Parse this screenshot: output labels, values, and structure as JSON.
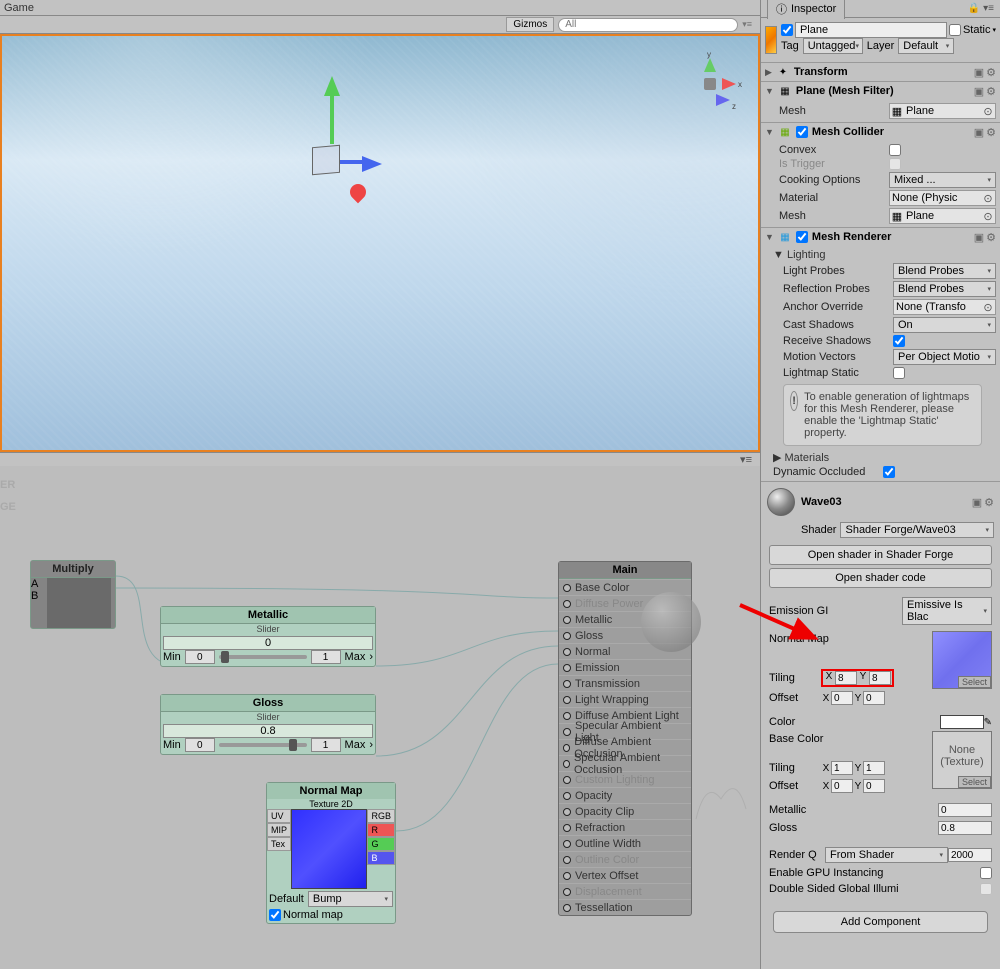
{
  "game": {
    "title": "Game",
    "gizmos": "Gizmos",
    "search_ph": "All"
  },
  "watermark1": "ER",
  "watermark2": "GE",
  "nodes": {
    "multiply": {
      "title": "Multiply"
    },
    "metallic": {
      "title": "Metallic",
      "sub": "Slider",
      "val": "0",
      "min": "Min",
      "minv": "0",
      "max": "Max",
      "maxv": "1"
    },
    "gloss": {
      "title": "Gloss",
      "sub": "Slider",
      "val": "0.8",
      "min": "Min",
      "minv": "0",
      "max": "Max",
      "maxv": "1"
    },
    "normalmap": {
      "title": "Normal Map",
      "sub": "Texture 2D",
      "uv": "UV",
      "mip": "MIP",
      "tex": "Tex",
      "rgb": "RGB",
      "r": "R",
      "g": "G",
      "b": "B",
      "def": "Default",
      "bump": "Bump",
      "nm": "Normal map"
    },
    "main": {
      "title": "Main",
      "ports": [
        "Base Color",
        "Diffuse Power",
        "Metallic",
        "Gloss",
        "Normal",
        "Emission",
        "Transmission",
        "Light Wrapping",
        "Diffuse Ambient Light",
        "Specular Ambient Light",
        "Diffuse Ambient Occlusion",
        "Specular Ambient Occlusion",
        "Custom Lighting",
        "Opacity",
        "Opacity Clip",
        "Refraction",
        "Outline Width",
        "Outline Color",
        "Vertex Offset",
        "Displacement",
        "Tessellation"
      ]
    }
  },
  "inspector": {
    "tab": "Inspector",
    "obj_name": "Plane",
    "static": "Static",
    "tag_lbl": "Tag",
    "tag_val": "Untagged",
    "layer_lbl": "Layer",
    "layer_val": "Default",
    "transform": "Transform",
    "meshfilter": {
      "title": "Plane (Mesh Filter)",
      "mesh_lbl": "Mesh",
      "mesh_val": "Plane"
    },
    "meshcollider": {
      "title": "Mesh Collider",
      "convex": "Convex",
      "istrigger": "Is Trigger",
      "cooking": "Cooking Options",
      "cooking_val": "Mixed ...",
      "material": "Material",
      "material_val": "None (Physic",
      "mesh": "Mesh",
      "mesh_val": "Plane"
    },
    "meshrenderer": {
      "title": "Mesh Renderer",
      "lighting": "Lighting",
      "lightprobes": "Light Probes",
      "lightprobes_v": "Blend Probes",
      "reflprobes": "Reflection Probes",
      "reflprobes_v": "Blend Probes",
      "anchor": "Anchor Override",
      "anchor_v": "None (Transfo",
      "castsh": "Cast Shadows",
      "castsh_v": "On",
      "recvsh": "Receive Shadows",
      "motion": "Motion Vectors",
      "motion_v": "Per Object Motio",
      "lmstatic": "Lightmap Static",
      "info": "To enable generation of lightmaps for this Mesh Renderer, please enable the 'Lightmap Static' property.",
      "materials": "Materials",
      "dynocc": "Dynamic Occluded"
    },
    "mat": {
      "name": "Wave03",
      "shader_lbl": "Shader",
      "shader_val": "Shader Forge/Wave03",
      "open_sf": "Open shader in Shader Forge",
      "open_code": "Open shader code",
      "emgi": "Emission GI",
      "emgi_v": "Emissive Is Blac",
      "normal": "Normal Map",
      "tiling": "Tiling",
      "offset": "Offset",
      "tilx": "8",
      "tily": "8",
      "offx": "0",
      "offy": "0",
      "select": "Select",
      "color": "Color",
      "basecolor": "Base Color",
      "none_tex": "None\n(Texture)",
      "bc_tilx": "1",
      "bc_tily": "1",
      "bc_offx": "0",
      "bc_offy": "0",
      "metallic": "Metallic",
      "metallic_v": "0",
      "gloss": "Gloss",
      "gloss_v": "0.8",
      "renderq": "Render Q",
      "renderq_v": "From Shader",
      "renderq_n": "2000",
      "gpu": "Enable GPU Instancing",
      "dsgi": "Double Sided Global Illumi"
    },
    "addcomp": "Add Component"
  }
}
